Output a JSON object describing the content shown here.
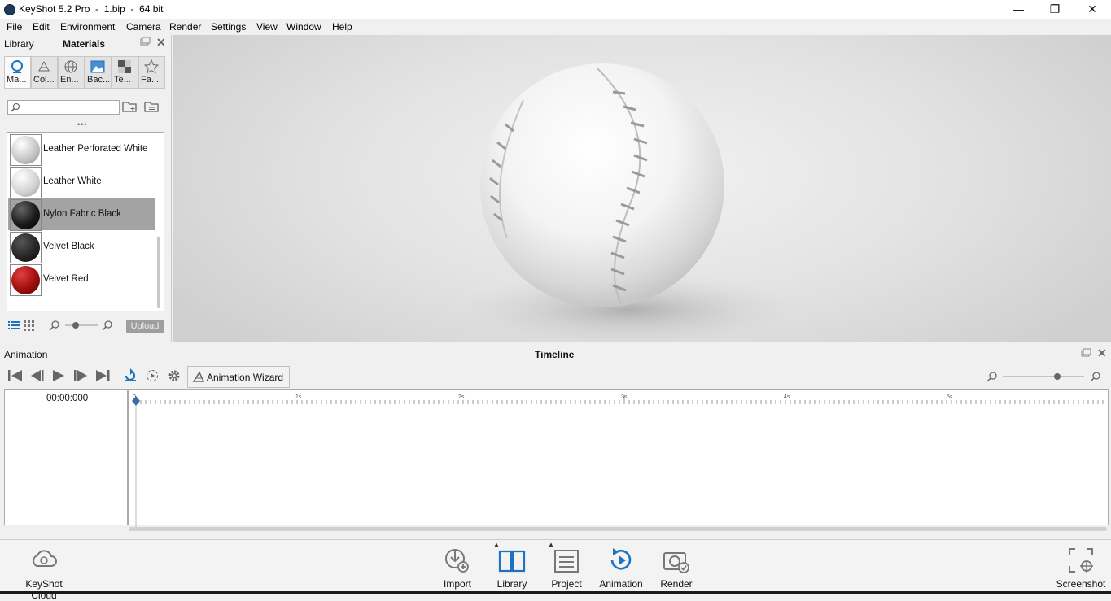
{
  "window": {
    "title": "KeyShot 5.2 Pro  -  1.bip  -  64 bit",
    "minimize_glyph": "—",
    "maximize_glyph": "❐",
    "close_glyph": "✕"
  },
  "menu": [
    "File",
    "Edit",
    "Environment",
    "Camera",
    "Render",
    "Settings",
    "View",
    "Window",
    "Help"
  ],
  "library_panel": {
    "header_left": "Library",
    "header_title": "Materials",
    "tabs": [
      {
        "label": "Ma...",
        "icon": "materials-icon",
        "active": true
      },
      {
        "label": "Col...",
        "icon": "colors-icon",
        "active": false
      },
      {
        "label": "En...",
        "icon": "environments-icon",
        "active": false
      },
      {
        "label": "Bac...",
        "icon": "backplates-icon",
        "active": false
      },
      {
        "label": "Te...",
        "icon": "textures-icon",
        "active": false
      },
      {
        "label": "Fa...",
        "icon": "favorites-icon",
        "active": false
      }
    ],
    "search_placeholder": "",
    "more_glyph": "•••",
    "materials": [
      {
        "name": "Leather Perforated White",
        "color": "#d4d4d4",
        "selected": false
      },
      {
        "name": "Leather White",
        "color": "#e0e0e0",
        "selected": false
      },
      {
        "name": "Nylon Fabric Black",
        "color": "#1a1a1a",
        "selected": true
      },
      {
        "name": "Velvet Black",
        "color": "#2a2a2a",
        "selected": false
      },
      {
        "name": "Velvet Red",
        "color": "#b01010",
        "selected": false
      }
    ],
    "upload_label": "Upload"
  },
  "animation": {
    "header_left": "Animation",
    "header_title": "Timeline",
    "wizard_label": "Animation Wizard",
    "time": "00:00:000",
    "ruler_labels": [
      "0",
      "1s",
      "2s",
      "3s",
      "4s",
      "5s"
    ]
  },
  "bottom_bar": {
    "cloud": "KeyShot Cloud",
    "buttons": [
      "Import",
      "Library",
      "Project",
      "Animation",
      "Render"
    ],
    "screenshot": "Screenshot"
  },
  "colors": {
    "accent_blue": "#1e73be",
    "selection_gray": "#a3a3a3"
  }
}
